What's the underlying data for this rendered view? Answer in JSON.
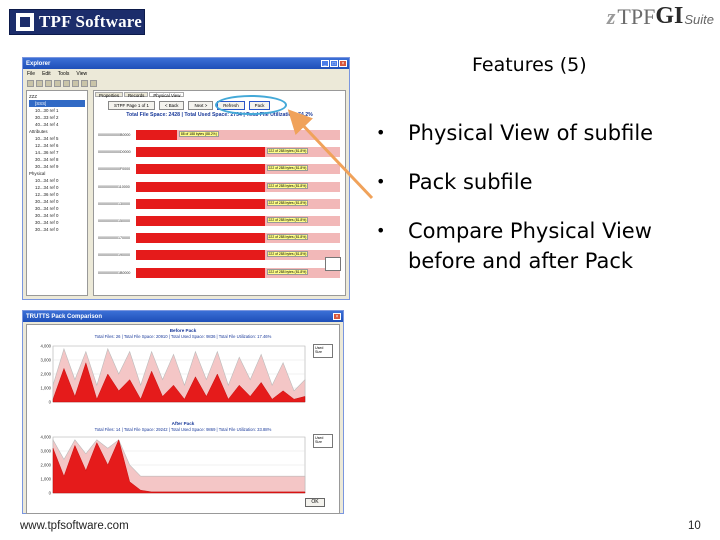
{
  "header": {
    "logo_left_text": "TPF Software",
    "logo_right_tpf": "TPF",
    "logo_right_gi": "GI",
    "logo_right_suite": "Suite"
  },
  "slide": {
    "title": "Features (5)",
    "bullets": [
      "Physical View of subfile",
      "Pack subfile",
      "Compare Physical View before and after Pack"
    ]
  },
  "window1": {
    "title": "Explorer",
    "menu": [
      "File",
      "Edit",
      "Tools",
      "View"
    ],
    "tree_items": [
      "ZZZ",
      "[SSS]",
      "10...30 ref 1",
      "30...33 ref 2",
      "40...34 ref 4",
      "Attributes",
      "10...34 ref 5",
      "12...34 ref 6",
      "14...36 ref 7",
      "30...34 ref 8",
      "30...34 ref 9",
      "Physical",
      "10...34 ref 0",
      "12...34 ref 0",
      "12...36 ref 0",
      "30...34 ref 0",
      "30...34 ref 0",
      "30...34 ref 0",
      "30...34 ref 0",
      "30...34 ref 0"
    ],
    "tabs": [
      "Properties",
      "Records",
      "Physical View"
    ],
    "page_label": "STPF Page 1 of 1",
    "prev_label": "< Back",
    "next_label": "Next >",
    "refresh_label": "Refresh",
    "pack_label": "Pack",
    "plot_title": "Total File Space: 2428 | Total Used Space: 2734 | Total File Utilization: 74.2%",
    "rows": [
      {
        "label": "00000000000B0000",
        "fill": 0.2,
        "tag": "88 of 188 bytes (88.2%)"
      },
      {
        "label": "00000000000D0000",
        "fill": 0.63,
        "tag": "222 of 288 bytes (81.8%)"
      },
      {
        "label": "00000000000F0000",
        "fill": 0.63,
        "tag": "222 of 288 bytes (81.8%)"
      },
      {
        "label": "0000000000110000",
        "fill": 0.63,
        "tag": "222 of 288 bytes (81.8%)"
      },
      {
        "label": "0000000000130000",
        "fill": 0.63,
        "tag": "222 of 288 bytes (81.8%)"
      },
      {
        "label": "0000000000150000",
        "fill": 0.63,
        "tag": "222 of 288 bytes (81.8%)"
      },
      {
        "label": "0000000000170000",
        "fill": 0.63,
        "tag": "222 of 288 bytes (81.8%)"
      },
      {
        "label": "0000000000190000",
        "fill": 0.63,
        "tag": "222 of 288 bytes (81.8%)"
      },
      {
        "label": "00000000001B0000",
        "fill": 0.63,
        "tag": "222 of 288 bytes (81.8%)"
      }
    ]
  },
  "window2": {
    "title": "TRUTTS Pack Comparison",
    "before_title": "Before Pack",
    "before_sub": "Total Files: 26 | Total File Space: 20910 | Total Used Space: 9836 | Total File Utilization: 17.46%",
    "after_title": "After Pack",
    "after_sub": "Total Files: 14 | Total File Space: 29242 | Total Used Space: 9869 | Total File Utilization: 33.88%",
    "before_yticks": [
      "4,000",
      "3,000",
      "2,000",
      "1,000",
      "0"
    ],
    "after_yticks": [
      "4,000",
      "3,000",
      "2,000",
      "1,000",
      "0"
    ],
    "legend_items": [
      "Used",
      "Size"
    ],
    "ok_label": "OK"
  },
  "footer": {
    "url": "www.tpfsoftware.com",
    "page": "10"
  },
  "colors": {
    "bar": "#e51b1b",
    "bar_bg": "#f2b8b8",
    "highlight_ring": "#44a9d8",
    "arrow": "#f0a25a",
    "logo_bg": "#1c2d6b"
  }
}
